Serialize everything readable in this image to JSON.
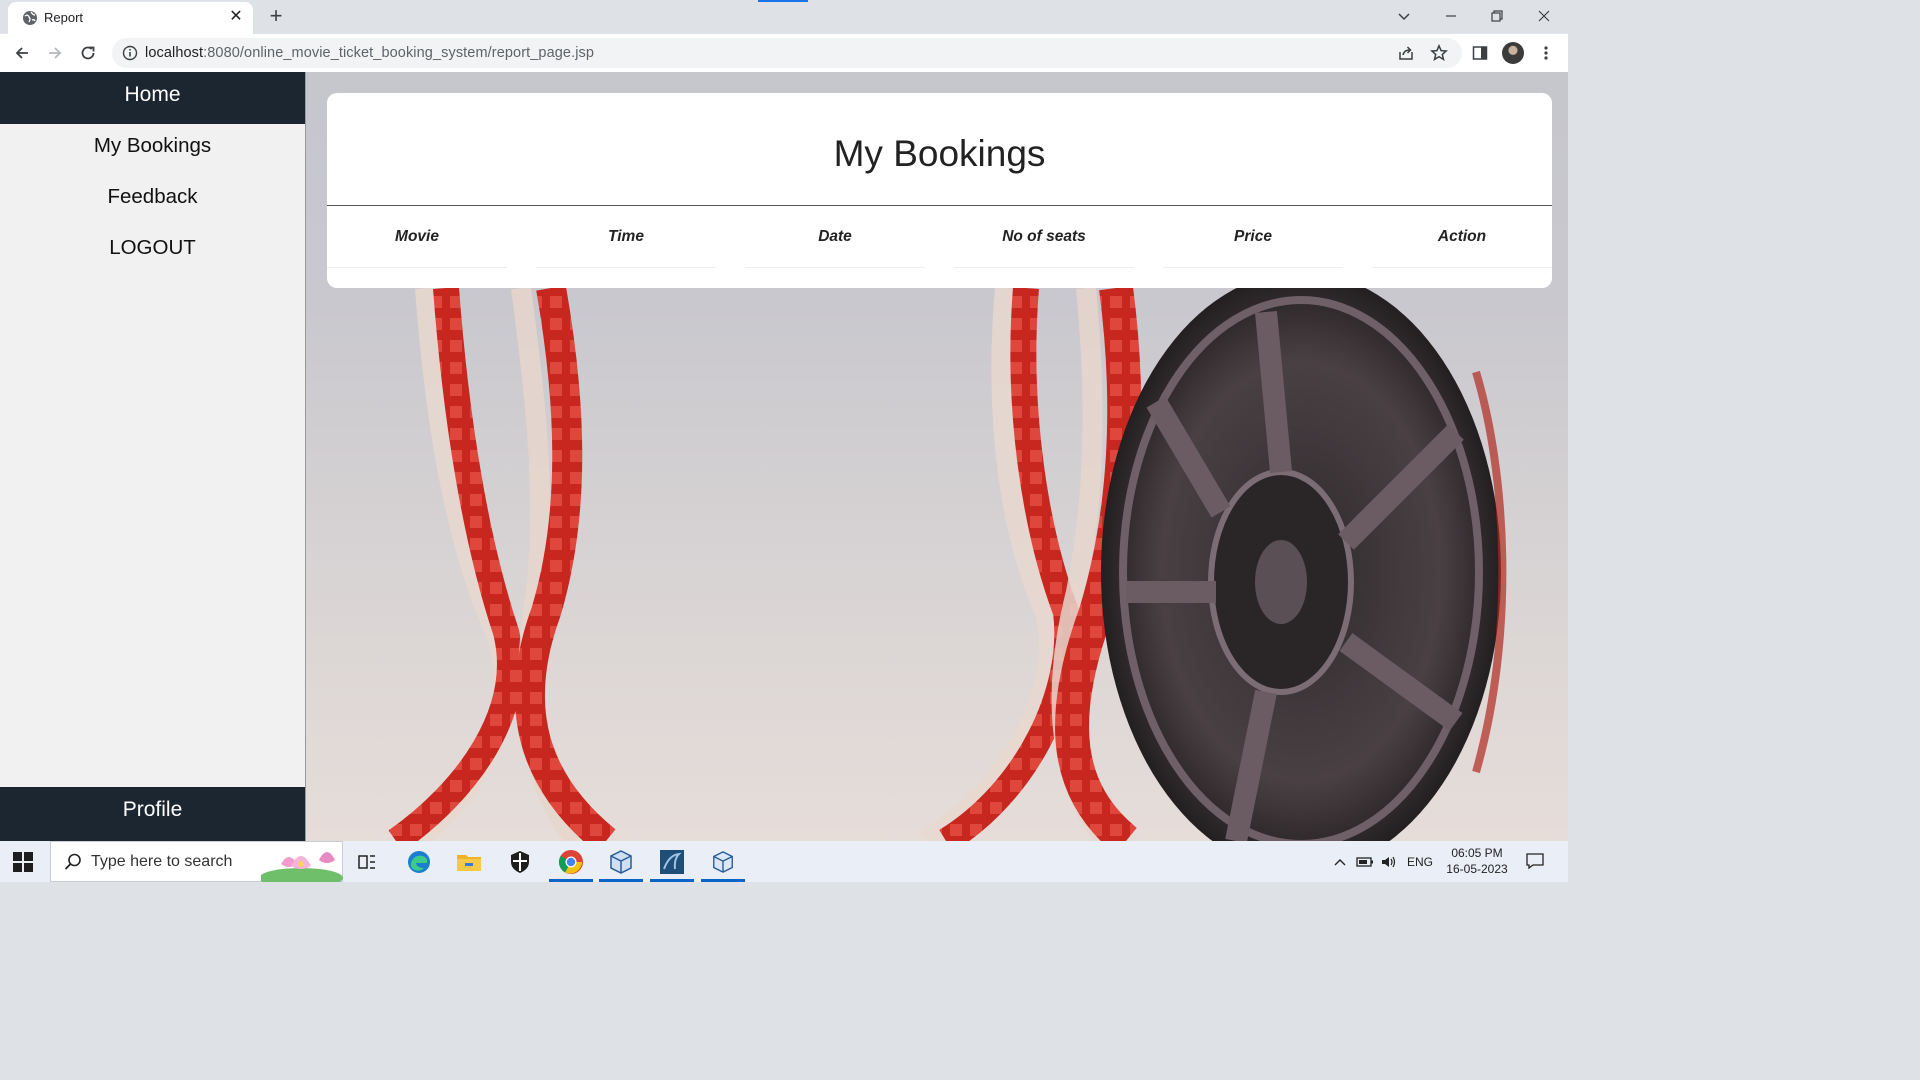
{
  "browser": {
    "tab_title": "Report",
    "url_host": "localhost",
    "url_rest": ":8080/online_movie_ticket_booking_system/report_page.jsp"
  },
  "sidebar": {
    "home_label": "Home",
    "items": [
      {
        "label": "My Bookings"
      },
      {
        "label": "Feedback"
      },
      {
        "label": "LOGOUT"
      }
    ],
    "profile_label": "Profile"
  },
  "main": {
    "title": "My Bookings",
    "table_headers": [
      "Movie",
      "Time",
      "Date",
      "No of seats",
      "Price",
      "Action"
    ]
  },
  "taskbar": {
    "search_placeholder": "Type here to search",
    "time": "06:05 PM",
    "date": "16-05-2023",
    "language": "ENG"
  },
  "colors": {
    "sidebar_dark": "#1b2631",
    "sidebar_bg": "#f1f1f1",
    "film_red": "#c8271f",
    "accent_blue": "#1a73e8"
  },
  "icons": [
    "globe-icon",
    "close-icon",
    "plus-icon",
    "chevron-down-icon",
    "minimize-icon",
    "restore-icon",
    "back-icon",
    "forward-icon",
    "reload-icon",
    "info-icon",
    "share-icon",
    "star-icon",
    "side-panel-icon",
    "menu-icon",
    "windows-icon",
    "search-icon",
    "task-view-icon",
    "edge-icon",
    "file-explorer-icon",
    "security-icon",
    "chrome-icon",
    "cube-icon",
    "mysql-icon",
    "battery-icon",
    "volume-icon",
    "notification-icon"
  ]
}
